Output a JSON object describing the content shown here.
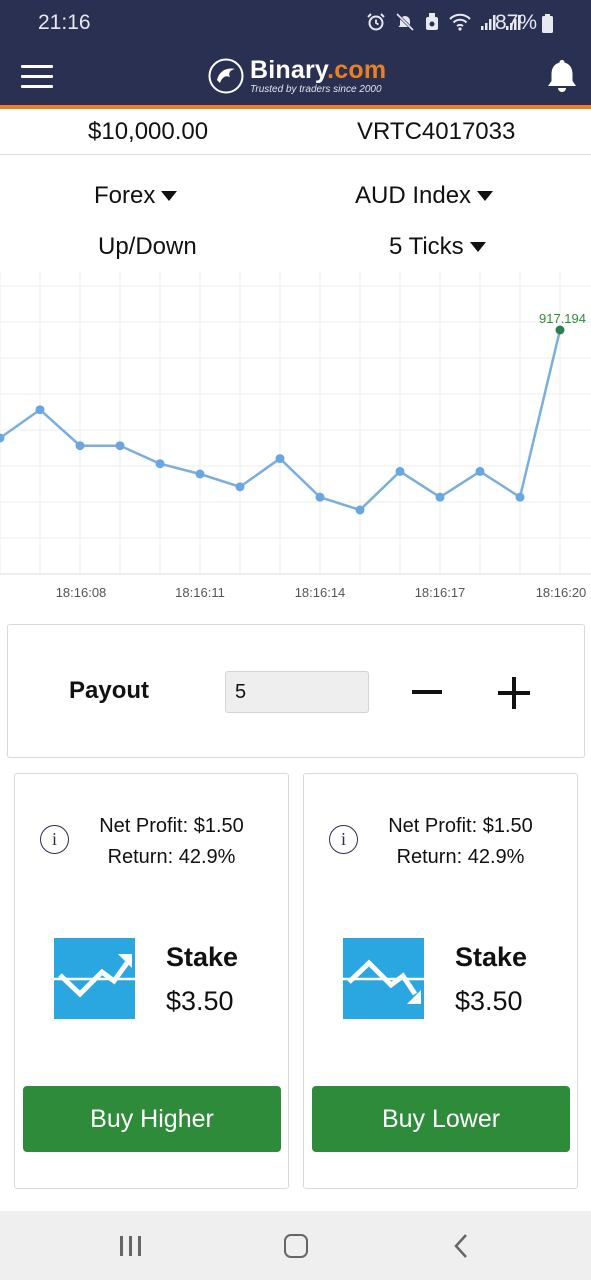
{
  "status_bar": {
    "time": "21:16",
    "battery_percent": "87%",
    "icons": [
      "alarm-icon",
      "mute-icon",
      "android-icon",
      "wifi-icon",
      "signal-icon",
      "signal-roaming-icon",
      "battery-icon"
    ]
  },
  "header": {
    "brand_name": "Binary",
    "brand_suffix": ".com",
    "tagline": "Trusted by traders since 2000",
    "menu_icon": "hamburger-menu-icon",
    "notification_icon": "bell-icon"
  },
  "account": {
    "balance": "$10,000.00",
    "account_id": "VRTC4017033"
  },
  "selectors": {
    "market": "Forex",
    "underlying": "AUD Index",
    "trade_type": "Up/Down",
    "duration": "5 Ticks"
  },
  "chart_data": {
    "type": "line",
    "x_tick_labels": [
      "18:16:08",
      "18:16:11",
      "18:16:14",
      "18:16:17",
      "18:16:20"
    ],
    "last_value_label": "917.194",
    "relative_levels": [
      0.58,
      0.69,
      0.55,
      0.55,
      0.48,
      0.44,
      0.39,
      0.5,
      0.35,
      0.3,
      0.45,
      0.35,
      0.45,
      0.35,
      1.0
    ],
    "grid": true,
    "colors": {
      "line": "#7aaede",
      "point": "#6aa6e0",
      "last_point": "#2e7d4f",
      "last_label": "#2e8b3a",
      "grid": "#ececec"
    }
  },
  "payout": {
    "label": "Payout",
    "value": "5",
    "decrement_icon": "minus-icon",
    "increment_icon": "plus-icon"
  },
  "contracts": [
    {
      "direction": "higher",
      "net_profit": "Net Profit: $1.50",
      "return": "Return: 42.9%",
      "stake_label": "Stake",
      "stake_value": "$3.50",
      "button_label": "Buy Higher",
      "icon": "trend-up-icon"
    },
    {
      "direction": "lower",
      "net_profit": "Net Profit: $1.50",
      "return": "Return: 42.9%",
      "stake_label": "Stake",
      "stake_value": "$3.50",
      "button_label": "Buy Lower",
      "icon": "trend-down-icon"
    }
  ],
  "nav": {
    "recent_icon": "recent-apps-icon",
    "home_icon": "home-icon",
    "back_icon": "back-icon"
  },
  "colors": {
    "header_bg": "#2a3052",
    "accent_orange": "#e98024",
    "buy_green": "#2e8b3a",
    "trade_icon_blue": "#2aa7e0"
  }
}
